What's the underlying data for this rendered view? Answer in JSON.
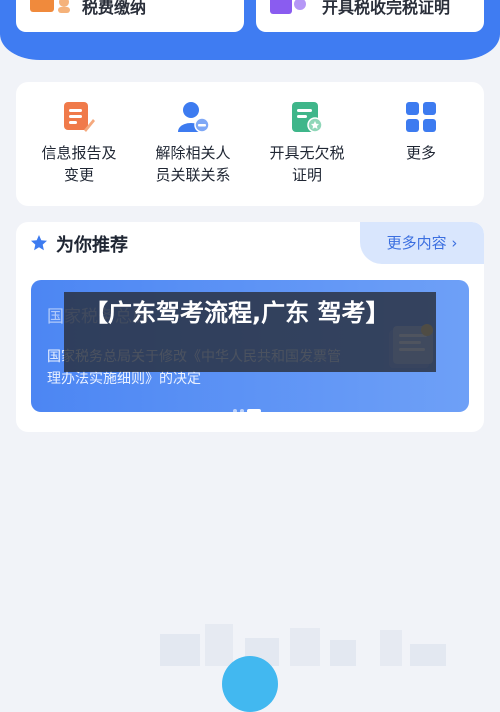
{
  "top_cards": [
    {
      "label": "税费缴纳",
      "icon": "tax-payment-icon",
      "color": "#f08a3c"
    },
    {
      "label": "开具税收完税证明",
      "icon": "certificate-icon",
      "color": "#8a5cf0"
    }
  ],
  "quick_actions": [
    {
      "label_line1": "信息报告及",
      "label_line2": "变更",
      "icon": "report-edit-icon",
      "color": "#f07a4a"
    },
    {
      "label_line1": "解除相关人",
      "label_line2": "员关联关系",
      "icon": "user-remove-icon",
      "color": "#3d7bf0"
    },
    {
      "label_line1": "开具无欠税",
      "label_line2": "证明",
      "icon": "document-badge-icon",
      "color": "#3fb68a"
    },
    {
      "label_line1": "更多",
      "label_line2": "",
      "icon": "grid-icon",
      "color": "#3d7bf0"
    }
  ],
  "recommend": {
    "title": "为你推荐",
    "more_label": "更多内容",
    "banner": {
      "heading": "国家税务总局",
      "body": "国家税务总局关于修改《中华人民共和国发票管理办法实施细则》的决定"
    }
  },
  "overlay": {
    "text": "【广东驾考流程,广东 驾考】"
  },
  "colors": {
    "brand_blue": "#3f7cf2",
    "page_bg": "#f1f3f8"
  }
}
